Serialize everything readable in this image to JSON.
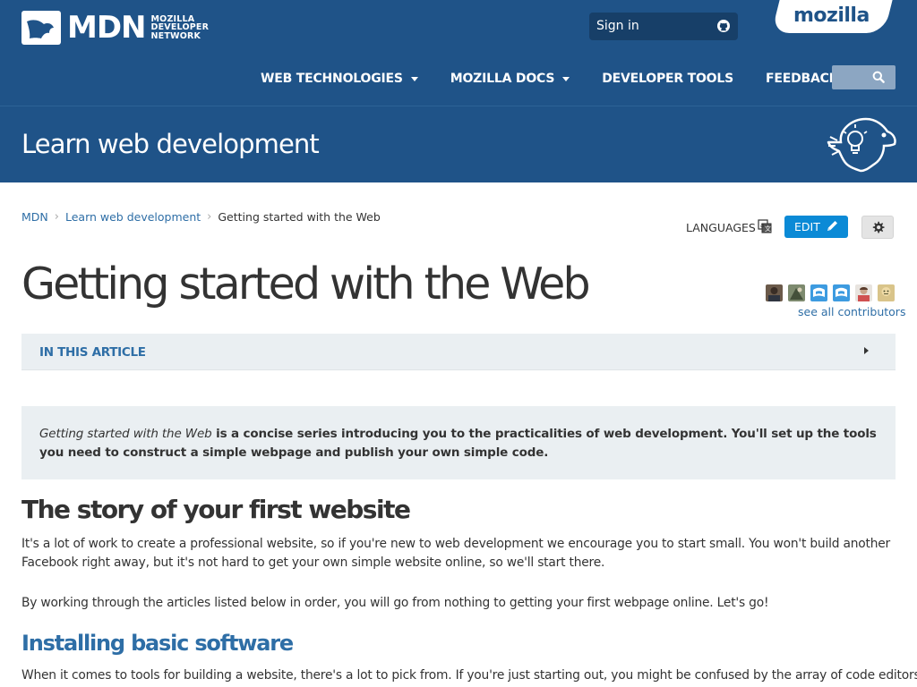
{
  "header": {
    "logo_text": "MDN",
    "logo_subtitle": [
      "MOZILLA",
      "DEVELOPER",
      "NETWORK"
    ],
    "sign_in_label": "Sign in",
    "sign_in_icon": "github-icon",
    "mozilla_label": "mozilla",
    "search_icon": "search-icon"
  },
  "nav": {
    "items": [
      {
        "label": "WEB TECHNOLOGIES",
        "dropdown": true
      },
      {
        "label": "MOZILLA DOCS",
        "dropdown": true
      },
      {
        "label": "DEVELOPER TOOLS",
        "dropdown": false
      },
      {
        "label": "FEEDBACK",
        "dropdown": true
      }
    ]
  },
  "banner": {
    "title": "Learn web development",
    "icon": "learning-dino-lightbulb-icon"
  },
  "breadcrumbs": {
    "items": [
      "MDN",
      "Learn web development"
    ],
    "current": "Getting started with the Web"
  },
  "actions": {
    "languages_label": "LANGUAGES",
    "languages_icon": "translate-icon",
    "edit_label": "EDIT",
    "edit_icon": "pencil-icon",
    "settings_icon": "gear-icon"
  },
  "article": {
    "title": "Getting started with the Web",
    "contributors_link": "see all contributors",
    "contributors_count": 6,
    "toc_label": "IN THIS ARTICLE",
    "summary_italic": "Getting started with the Web",
    "summary_rest": " is a concise series introducing you to the practicalities of web development. You'll set up the tools you need to construct a simple webpage and publish your own simple code.",
    "section_heading": "The story of your first website",
    "paragraph_1": "It's a lot of work to create a professional website, so if you're new to web development we encourage you to start small. You won't build another Facebook right away, but it's not hard to get your own simple website online, so we'll start there.",
    "paragraph_2": "By working through the articles listed below in order, you will go from nothing to getting your first webpage online. Let's go!",
    "subheading": "Installing basic software",
    "paragraph_3": "When it comes to tools for building a website, there's a lot to pick from. If you're just starting out, you might be confused by the array of code editors,"
  },
  "colors": {
    "header_bg": "#1f5388",
    "link": "#2e6ea6",
    "edit_button": "#0b8ad6",
    "panel_bg": "#eaeff2"
  }
}
